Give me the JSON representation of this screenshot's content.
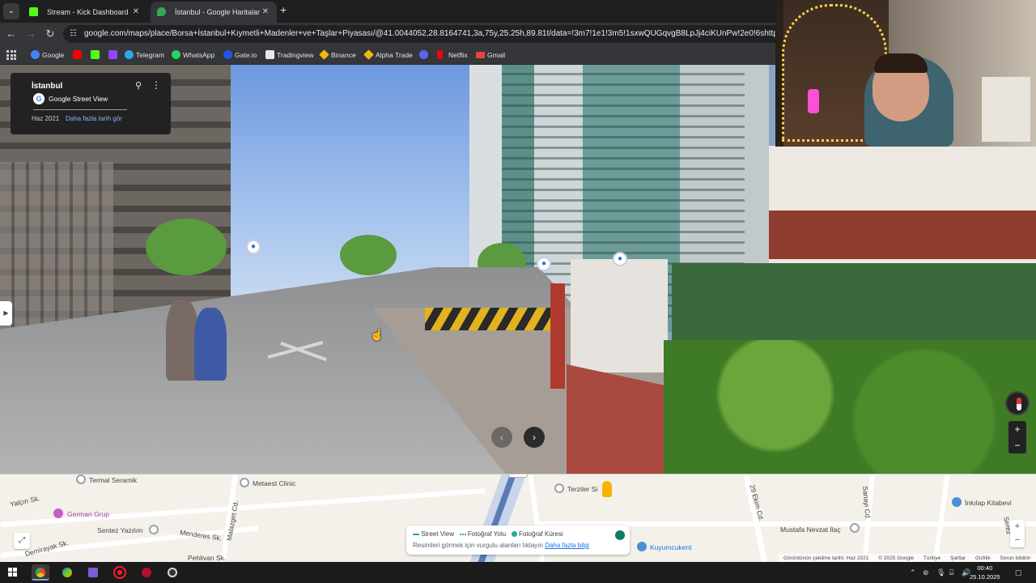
{
  "browser": {
    "tabs": [
      {
        "title": "Stream - Kick Dashboard",
        "favicon_color": "#53fc18"
      },
      {
        "title": "İstanbul - Google Haritalar",
        "favicon_color": "#34a853"
      }
    ],
    "url": "google.com/maps/place/Borsa+İstanbul+Kıymetli+Madenler+ve+Taşlar+Piyasası/@41.0044052,28.8164741,3a,75y,25.25h,89.81t/data=!3m7!1e1!3m5!1sxwQUGqvgB8LpJj4ciKUnPw!2e0!6shttps:%2F%2Fstreetv",
    "bookmarks": [
      {
        "label": "Google",
        "color": "#4285f4"
      },
      {
        "label": "",
        "color": "#ff0000"
      },
      {
        "label": "",
        "color": "#53fc18"
      },
      {
        "label": "",
        "color": "#9146ff"
      },
      {
        "label": "Telegram",
        "color": "#29a9eb"
      },
      {
        "label": "WhatsApp",
        "color": "#25d366"
      },
      {
        "label": "Gate.io",
        "color": "#2354e6"
      },
      {
        "label": "Tradingview",
        "color": "#131722"
      },
      {
        "label": "Binance",
        "color": "#f0b90b"
      },
      {
        "label": "Alpha Trade",
        "color": "#f0b90b"
      },
      {
        "label": "",
        "color": "#5865f2"
      },
      {
        "label": "Netflix",
        "color": "#e50914"
      },
      {
        "label": "Gmail",
        "color": "#ea4335"
      }
    ]
  },
  "streetview": {
    "location": "İstanbul",
    "source": "Google Street View",
    "date": "Haz 2021",
    "more_dates": "Daha fazla tarih gör"
  },
  "map": {
    "labels": {
      "termal": "Termal Seramik",
      "metaest": "Metaest Clinic",
      "terziler": "Terziler Si",
      "inkilap": "İnkılap Kitabevi",
      "yalcin": "Yalçın Sk.",
      "german": "German Grup",
      "sentez": "Sentez Yazılım",
      "menderes": "Menderes Sk.",
      "malazgirt": "Malazgirt Cd.",
      "demirayak": "Demirayak Sk.",
      "pehlivan": "Pehlivan Sk.",
      "ekim": "29 Ekim Cd.",
      "sanayi": "Sanayi Cd.",
      "mustafa": "Mustafa Nevzat İlaç",
      "kuyumcukent": "Kuyumcukent",
      "serez": "Serez"
    },
    "legend": {
      "street_view": "Street View",
      "photo_path": "Fotoğraf Yolu",
      "photo_sphere": "Fotoğraf Küresi",
      "hint": "Resimleri görmek için vurgulu alanları tıklayın",
      "more_info": "Daha fazla bilgi"
    },
    "attribution": {
      "capture": "Görüntünün çekilme tarihi: Haz 2021",
      "copyright": "© 2025 Google",
      "country": "Türkiye",
      "terms": "Şartlar",
      "privacy": "Gizlilik",
      "report": "Sorun bildirin"
    }
  },
  "taskbar": {
    "time": "00:40",
    "date": "25.10.2025"
  }
}
